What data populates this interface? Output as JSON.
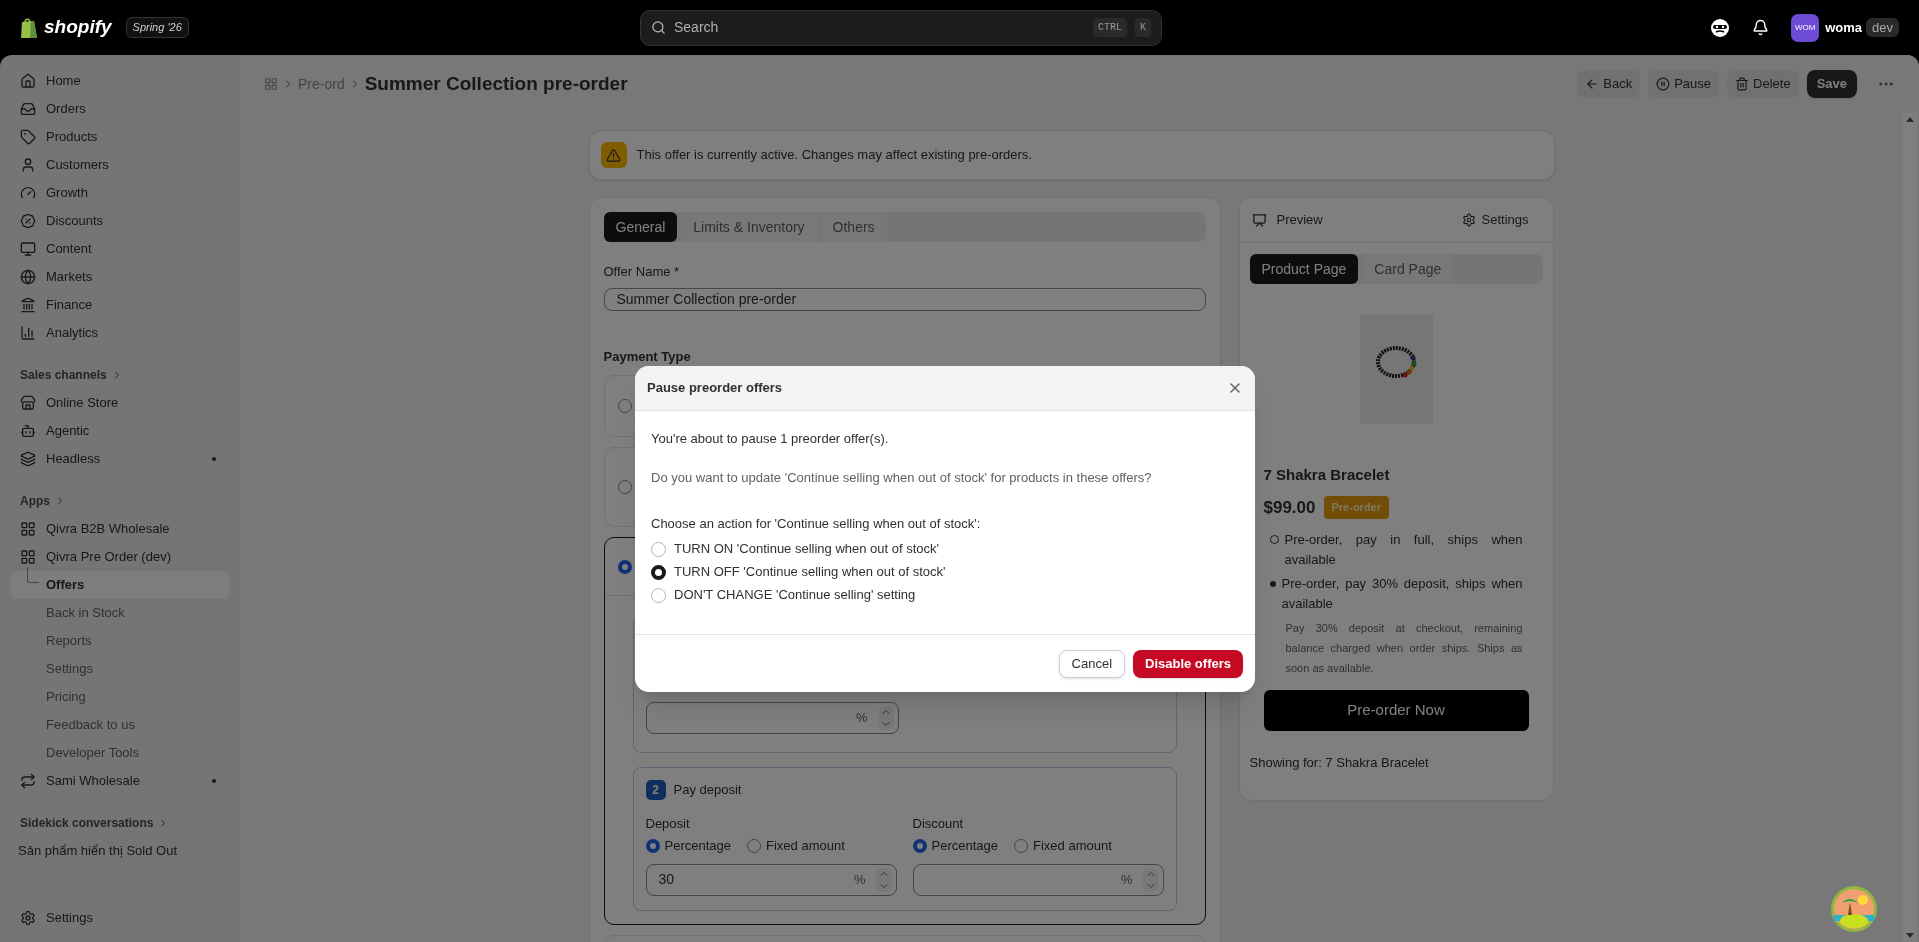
{
  "topbar": {
    "logo": "shopify",
    "edition": "Spring '26",
    "search": {
      "placeholder": "Search",
      "shortcut": [
        "CTRL",
        "K"
      ]
    },
    "avatar": "WOM",
    "user": "woma",
    "user_tag": "dev"
  },
  "sidebar": {
    "items": [
      {
        "label": "Home"
      },
      {
        "label": "Orders"
      },
      {
        "label": "Products"
      },
      {
        "label": "Customers"
      },
      {
        "label": "Growth"
      },
      {
        "label": "Discounts"
      },
      {
        "label": "Content"
      },
      {
        "label": "Markets"
      },
      {
        "label": "Finance"
      },
      {
        "label": "Analytics"
      }
    ],
    "sales_channels": {
      "heading": "Sales channels",
      "items": [
        {
          "label": "Online Store",
          "dot": false
        },
        {
          "label": "Agentic",
          "dot": false
        },
        {
          "label": "Headless",
          "dot": true
        }
      ]
    },
    "apps": {
      "heading": "Apps",
      "items": [
        {
          "label": "Qivra B2B Wholesale",
          "dot": false
        },
        {
          "label": "Qivra Pre Order (dev)",
          "dot": false,
          "children": [
            {
              "label": "Offers",
              "selected": true
            },
            {
              "label": "Back in Stock",
              "selected": false
            },
            {
              "label": "Reports",
              "selected": false
            },
            {
              "label": "Settings",
              "selected": false
            },
            {
              "label": "Pricing",
              "selected": false
            },
            {
              "label": "Feedback to us",
              "selected": false
            },
            {
              "label": "Developer Tools",
              "selected": false
            }
          ]
        },
        {
          "label": "Sami Wholesale",
          "dot": true
        }
      ]
    },
    "sidekick": {
      "heading": "Sidekick conversations",
      "items": [
        "Sản phẩm hiển thị Sold Out"
      ]
    },
    "settings": "Settings"
  },
  "header": {
    "breadcrumb": "Pre-ord",
    "title": "Summer Collection pre-order",
    "actions": [
      {
        "label": "Back",
        "kind": "back"
      },
      {
        "label": "Pause",
        "kind": "pause"
      },
      {
        "label": "Delete",
        "kind": "delete"
      },
      {
        "label": "Save",
        "kind": "primary"
      }
    ]
  },
  "banner": "This offer is currently active. Changes may affect existing pre-orders.",
  "form": {
    "tabs": [
      {
        "label": "General",
        "selected": true
      },
      {
        "label": "Limits & Inventory",
        "selected": false
      },
      {
        "label": "Others",
        "selected": false
      }
    ],
    "offer_name": {
      "label": "Offer Name *",
      "value": "Summer Collection pre-order"
    },
    "payment_type": {
      "heading": "Payment Type",
      "options": [
        {
          "selected": false
        },
        {
          "selected": false
        },
        {
          "selected": true
        }
      ]
    },
    "first_payment": {
      "unit": "%"
    },
    "deposit_section": {
      "number": "2",
      "title": "Pay deposit",
      "groups": [
        {
          "label": "Deposit",
          "choices": [
            {
              "label": "Percentage",
              "selected": true
            },
            {
              "label": "Fixed amount",
              "selected": false
            }
          ],
          "value": "30",
          "unit": "%"
        },
        {
          "label": "Discount",
          "choices": [
            {
              "label": "Percentage",
              "selected": true
            },
            {
              "label": "Fixed amount",
              "selected": false
            }
          ],
          "unit": "%"
        }
      ]
    }
  },
  "preview": {
    "title": "Preview",
    "settings": "Settings",
    "tabs": [
      {
        "label": "Product Page",
        "selected": true
      },
      {
        "label": "Card Page",
        "selected": false
      }
    ],
    "product": "7 Shakra Bracelet",
    "price": "$99.00",
    "badge": "Pre-order",
    "options": [
      {
        "label": "Pre-order, pay in full, ships when available",
        "selected": false
      },
      {
        "label": "Pre-order, pay 30% deposit, ships when available",
        "selected": true
      }
    ],
    "note": "Pay 30% deposit at checkout, remaining balance charged when order ships. Ships as soon as available.",
    "button": "Pre-order Now",
    "showing_for": "Showing for: 7 Shakra Bracelet"
  },
  "modal": {
    "title": "Pause preorder offers",
    "message": "You're about to pause 1 preorder offer(s).",
    "question": "Do you want to update 'Continue selling when out of stock' for products in these offers?",
    "prompt": "Choose an action for 'Continue selling when out of stock':",
    "choices": [
      {
        "label": "TURN ON 'Continue selling when out of stock'",
        "selected": false
      },
      {
        "label": "TURN OFF 'Continue selling when out of stock'",
        "selected": true
      },
      {
        "label": "DON'T CHANGE 'Continue selling' setting",
        "selected": false
      }
    ],
    "cancel": "Cancel",
    "confirm": "Disable offers"
  }
}
